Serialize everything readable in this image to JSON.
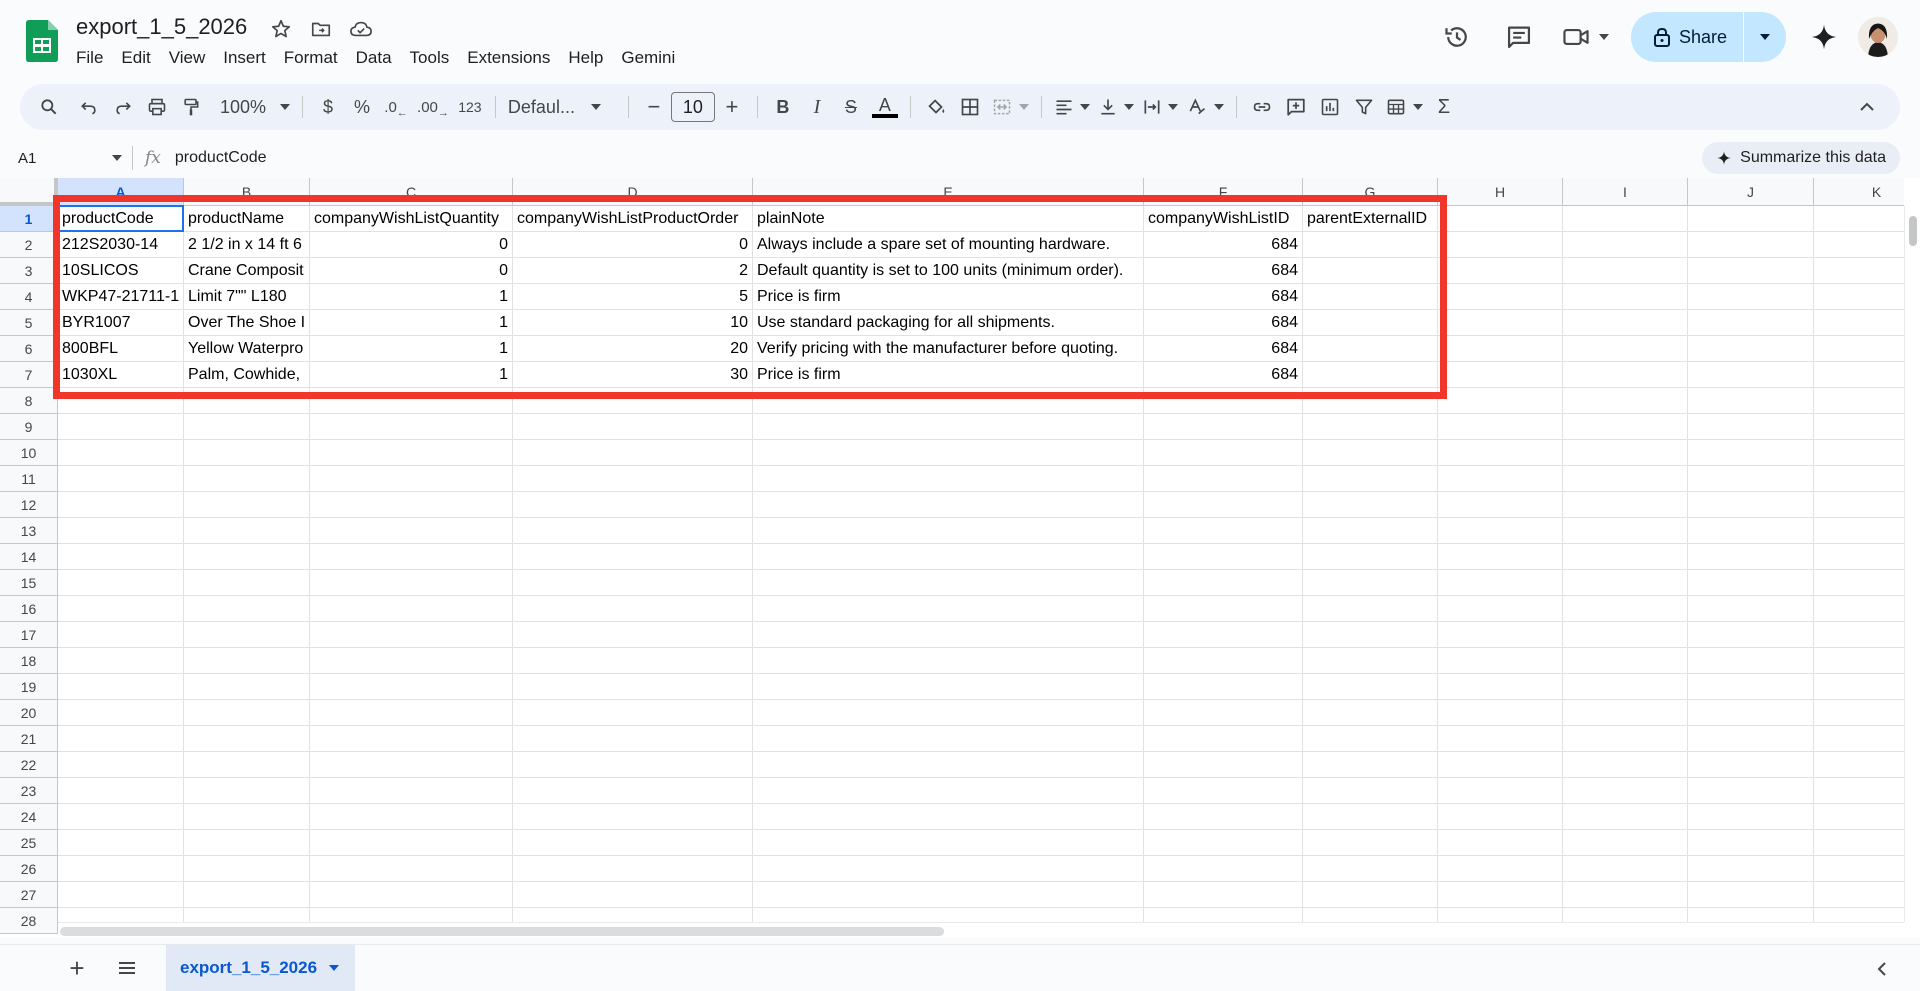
{
  "doc": {
    "title": "export_1_5_2026"
  },
  "menu": [
    "File",
    "Edit",
    "View",
    "Insert",
    "Format",
    "Data",
    "Tools",
    "Extensions",
    "Help",
    "Gemini"
  ],
  "share": {
    "label": "Share"
  },
  "toolbar": {
    "zoom": "100%",
    "currency": "$",
    "percent": "%",
    "dec_decrease": ".0",
    "dec_increase": ".00",
    "number_format": "123",
    "font": "Defaul...",
    "font_size": "10",
    "minus": "−",
    "plus": "+",
    "bold": "B",
    "italic": "I",
    "strike": "S",
    "text_color": "A",
    "sum": "Σ"
  },
  "formula": {
    "cell_ref": "A1",
    "fx": "fx",
    "value": "productCode",
    "summarize_label": "Summarize this data"
  },
  "columns": [
    {
      "letter": "A",
      "width": 126
    },
    {
      "letter": "B",
      "width": 126
    },
    {
      "letter": "C",
      "width": 203
    },
    {
      "letter": "D",
      "width": 240
    },
    {
      "letter": "E",
      "width": 391
    },
    {
      "letter": "F",
      "width": 159
    },
    {
      "letter": "G",
      "width": 135
    },
    {
      "letter": "H",
      "width": 125
    },
    {
      "letter": "I",
      "width": 125
    },
    {
      "letter": "J",
      "width": 126
    },
    {
      "letter": "K",
      "width": 126
    }
  ],
  "rows": {
    "count": 28,
    "height": 26
  },
  "table": {
    "headers": [
      "productCode",
      "productName",
      "companyWishListQuantity",
      "companyWishListProductOrder",
      "plainNote",
      "companyWishListID",
      "parentExternalID"
    ],
    "numeric_columns": [
      2,
      3,
      5
    ],
    "data": [
      [
        "212S2030-14",
        "2 1/2 in x 14 ft 6",
        "0",
        "0",
        "Always include a spare set of mounting hardware.",
        "684",
        ""
      ],
      [
        "10SLICOS",
        "Crane Composit",
        "0",
        "2",
        "Default quantity is set to 100 units (minimum order).",
        "684",
        ""
      ],
      [
        "WKP47-21711-1",
        "Limit 7\"\" L180",
        "1",
        "5",
        "Price is firm",
        "684",
        ""
      ],
      [
        "BYR1007",
        "Over The Shoe I",
        "1",
        "10",
        "Use standard packaging for all shipments.",
        "684",
        ""
      ],
      [
        "800BFL",
        "Yellow Waterpro",
        "1",
        "20",
        "Verify pricing with the manufacturer before quoting.",
        "684",
        ""
      ],
      [
        "1030XL",
        "Palm, Cowhide,",
        "1",
        "30",
        "Price is firm",
        "684",
        ""
      ]
    ]
  },
  "sheets": [
    {
      "name": "export_1_5_2026",
      "active": true
    }
  ],
  "colors": {
    "accent": "#0b57d0",
    "selection": "#1a73e8",
    "highlight_box": "#f2352b",
    "share_bg": "#c2e7ff"
  }
}
